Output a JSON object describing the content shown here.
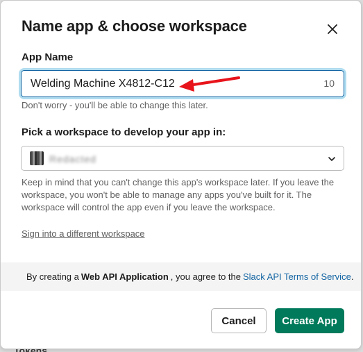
{
  "backdrop": {
    "peek_text": "Tokens"
  },
  "modal": {
    "title": "Name app & choose workspace",
    "close_icon": "close-icon"
  },
  "app_name": {
    "label": "App Name",
    "value": "Welding Machine X4812-C12",
    "char_count": "10",
    "hint": "Don't worry - you'll be able to change this later."
  },
  "workspace": {
    "label": "Pick a workspace to develop your app in:",
    "selected": "Redacted",
    "hint": "Keep in mind that you can't change this app's workspace later. If you leave the workspace, you won't be able to manage any apps you've built for it. The workspace will control the app even if you leave the workspace.",
    "sign_in_link": "Sign into a different workspace"
  },
  "terms": {
    "prefix": "By creating a",
    "bold": "Web API Application",
    "middle": ", you agree to the",
    "link": "Slack API Terms of Service",
    "suffix": "."
  },
  "buttons": {
    "cancel": "Cancel",
    "create": "Create App"
  },
  "colors": {
    "primary_button": "#007a5a",
    "focus_ring": "#1d9bd1",
    "link": "#1264a3",
    "annotation_arrow": "#e8141b"
  }
}
